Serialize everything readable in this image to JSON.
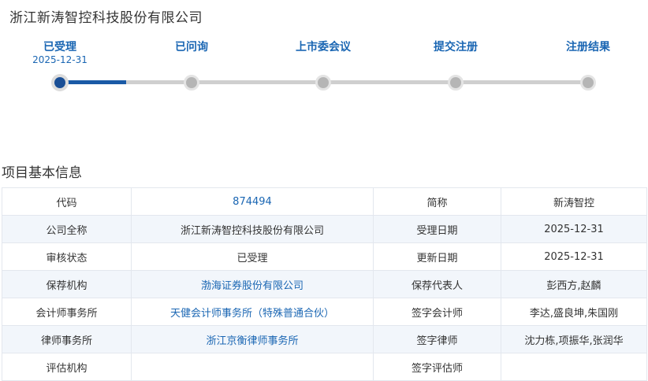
{
  "company_title": "浙江新涛智控科技股份有限公司",
  "steps": [
    {
      "label": "已受理",
      "date": "2025-12-31",
      "state": "current"
    },
    {
      "label": "已问询",
      "date": "",
      "state": "pending"
    },
    {
      "label": "上市委会议",
      "date": "",
      "state": "pending"
    },
    {
      "label": "提交注册",
      "date": "",
      "state": "pending"
    },
    {
      "label": "注册结果",
      "date": "",
      "state": "pending"
    }
  ],
  "colors": {
    "accent": "#1a66b3",
    "track": "#cfcfcf",
    "row_alt": "#f2f6fb"
  },
  "section_title": "项目基本信息",
  "rows": [
    {
      "k1": "代码",
      "v1": "874494",
      "k2": "简称",
      "v2": "新涛智控"
    },
    {
      "k1": "公司全称",
      "v1": "浙江新涛智控科技股份有限公司",
      "k2": "受理日期",
      "v2": "2025-12-31"
    },
    {
      "k1": "审核状态",
      "v1": "已受理",
      "k2": "更新日期",
      "v2": "2025-12-31"
    },
    {
      "k1": "保荐机构",
      "v1": "渤海证券股份有限公司",
      "k2": "保荐代表人",
      "v2": "彭西方,赵麟"
    },
    {
      "k1": "会计师事务所",
      "v1": "天健会计师事务所（特殊普通合伙）",
      "k2": "签字会计师",
      "v2": "李达,盛良坤,朱国刚"
    },
    {
      "k1": "律师事务所",
      "v1": "浙江京衡律师事务所",
      "k2": "签字律师",
      "v2": "沈力栋,项振华,张润华"
    },
    {
      "k1": "评估机构",
      "v1": "",
      "k2": "签字评估师",
      "v2": ""
    }
  ]
}
